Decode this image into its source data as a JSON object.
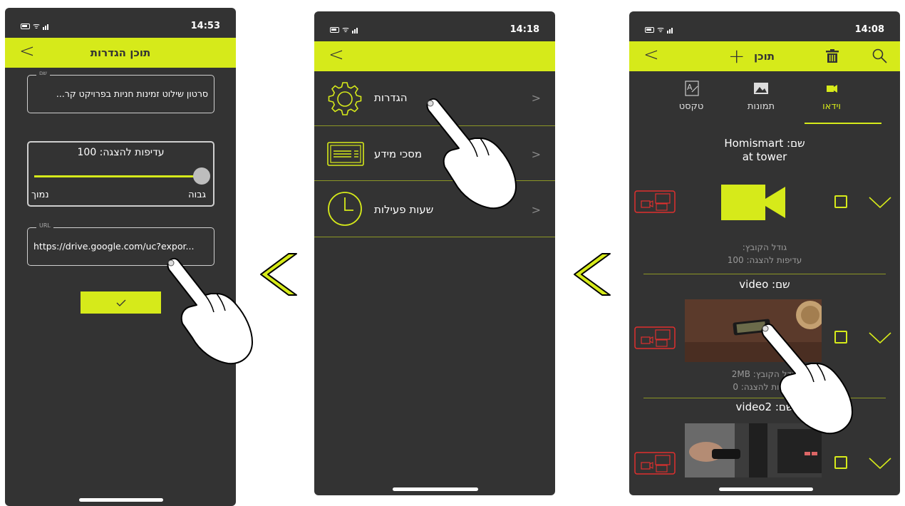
{
  "accent_color": "#d6ea1a",
  "warning_color": "#e0302e",
  "screen1": {
    "time": "14:53",
    "title": "תוכן הגדרות",
    "name_label": "שם",
    "name_value": "סרטון שילוט זמינות חניות בפרויקט קר...",
    "priority_label": "עדיפות להצגה: 100",
    "slider_high": "גבוה",
    "slider_low": "נמוך",
    "slider_value": 1.0,
    "url_label": "URL",
    "url_value": "https://drive.google.com/uc?expor...",
    "confirm_icon": "check-icon"
  },
  "screen2": {
    "time": "14:18",
    "menu": [
      {
        "label": "הגדרות",
        "icon": "gear-icon"
      },
      {
        "label": "מסכי מידע",
        "icon": "info-screen-icon"
      },
      {
        "label": "שעות פעילות",
        "icon": "clock-icon"
      }
    ]
  },
  "screen3": {
    "time": "14:08",
    "title": "תוכן",
    "tabs": [
      {
        "label": "טקסט",
        "icon": "text-icon"
      },
      {
        "label": "תמונות",
        "icon": "image-icon"
      },
      {
        "label": "וידאו",
        "icon": "video-icon"
      }
    ],
    "items": [
      {
        "title_line1": "שם: Homismart",
        "title_line2": "at tower",
        "size": "גודל הקובץ:",
        "priority": "עדיפות להצגה: 100"
      },
      {
        "title": "שם: video",
        "size": "גודל הקובץ: 2MB",
        "priority": "עדיפות להצגה: 0"
      },
      {
        "title": "שם: video2"
      }
    ]
  }
}
